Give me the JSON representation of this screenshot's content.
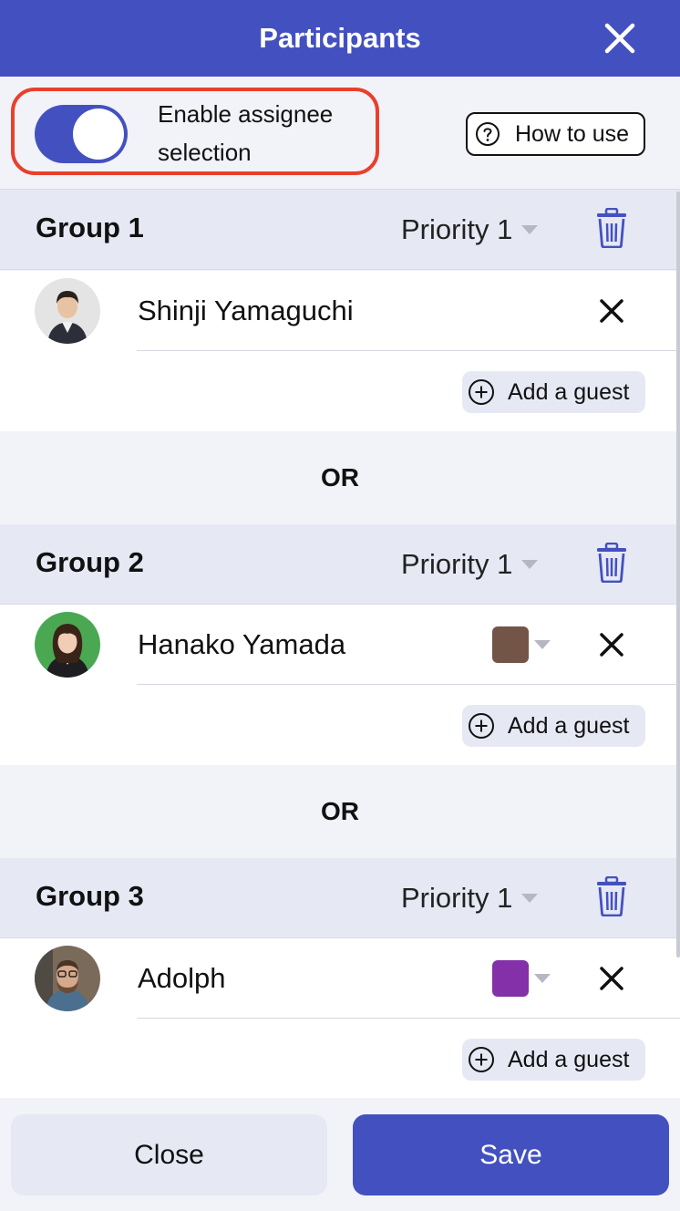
{
  "header": {
    "title": "Participants",
    "close_icon": "close-icon"
  },
  "toolbar": {
    "toggle_label": "Enable assignee selection",
    "toggle_on": true,
    "how_to_label": "How to use"
  },
  "groups": [
    {
      "title": "Group 1",
      "priority": "Priority 1",
      "member": {
        "name": "Shinji Yamaguchi",
        "color": null,
        "avatar_bg": "#e4e4e4"
      },
      "guest_label": "Add a guest"
    },
    {
      "title": "Group 2",
      "priority": "Priority 1",
      "member": {
        "name": "Hanako Yamada",
        "color": "#735548",
        "avatar_bg": "#4aa853"
      },
      "guest_label": "Add a guest"
    },
    {
      "title": "Group 3",
      "priority": "Priority 1",
      "member": {
        "name": "Adolph",
        "color": "#8430a8",
        "avatar_bg": "#7a6a5a"
      },
      "guest_label": "Add a guest"
    }
  ],
  "separator": "OR",
  "footer": {
    "close_label": "Close",
    "save_label": "Save"
  },
  "colors": {
    "accent": "#4351c0",
    "highlight": "#e8402d"
  }
}
